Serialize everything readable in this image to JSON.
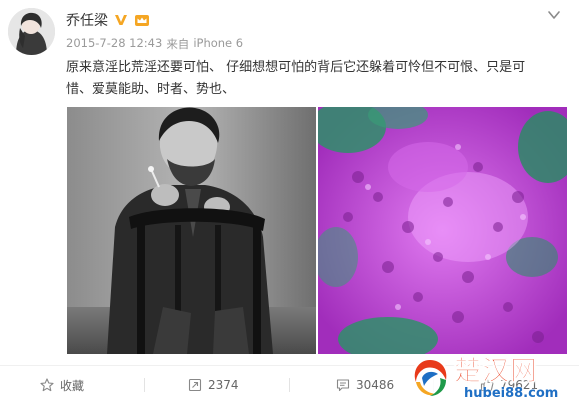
{
  "post": {
    "username": "乔任梁",
    "timestamp": "2015-7-28 12:43",
    "source_prefix": "来自",
    "source": "iPhone 6",
    "text_lines": [
      "原来意淫比荒淫还要可怕、  仔细想想可怕的背后它还躲着可怜但不可恨、只是可",
      "惜、爱莫能助、时者、势也、"
    ],
    "icons": {
      "more": "chevron-down-icon",
      "verified": "verified-v-icon",
      "member": "member-crown-icon"
    }
  },
  "actions": {
    "favorite": {
      "label": "收藏",
      "icon": "star-icon"
    },
    "repost": {
      "count": "2374",
      "icon": "repost-icon"
    },
    "comment": {
      "count": "30486",
      "icon": "comment-icon"
    },
    "like": {
      "count": "79621",
      "icon": "thumb-up-icon"
    }
  },
  "watermark": {
    "title": "楚汉网",
    "url": "hubei88.com"
  },
  "colors": {
    "verified_orange": "#f5a623",
    "watermark_red": "#e83a1a",
    "watermark_blue": "#1f6fc4",
    "meta_gray": "#9a9a9a"
  }
}
